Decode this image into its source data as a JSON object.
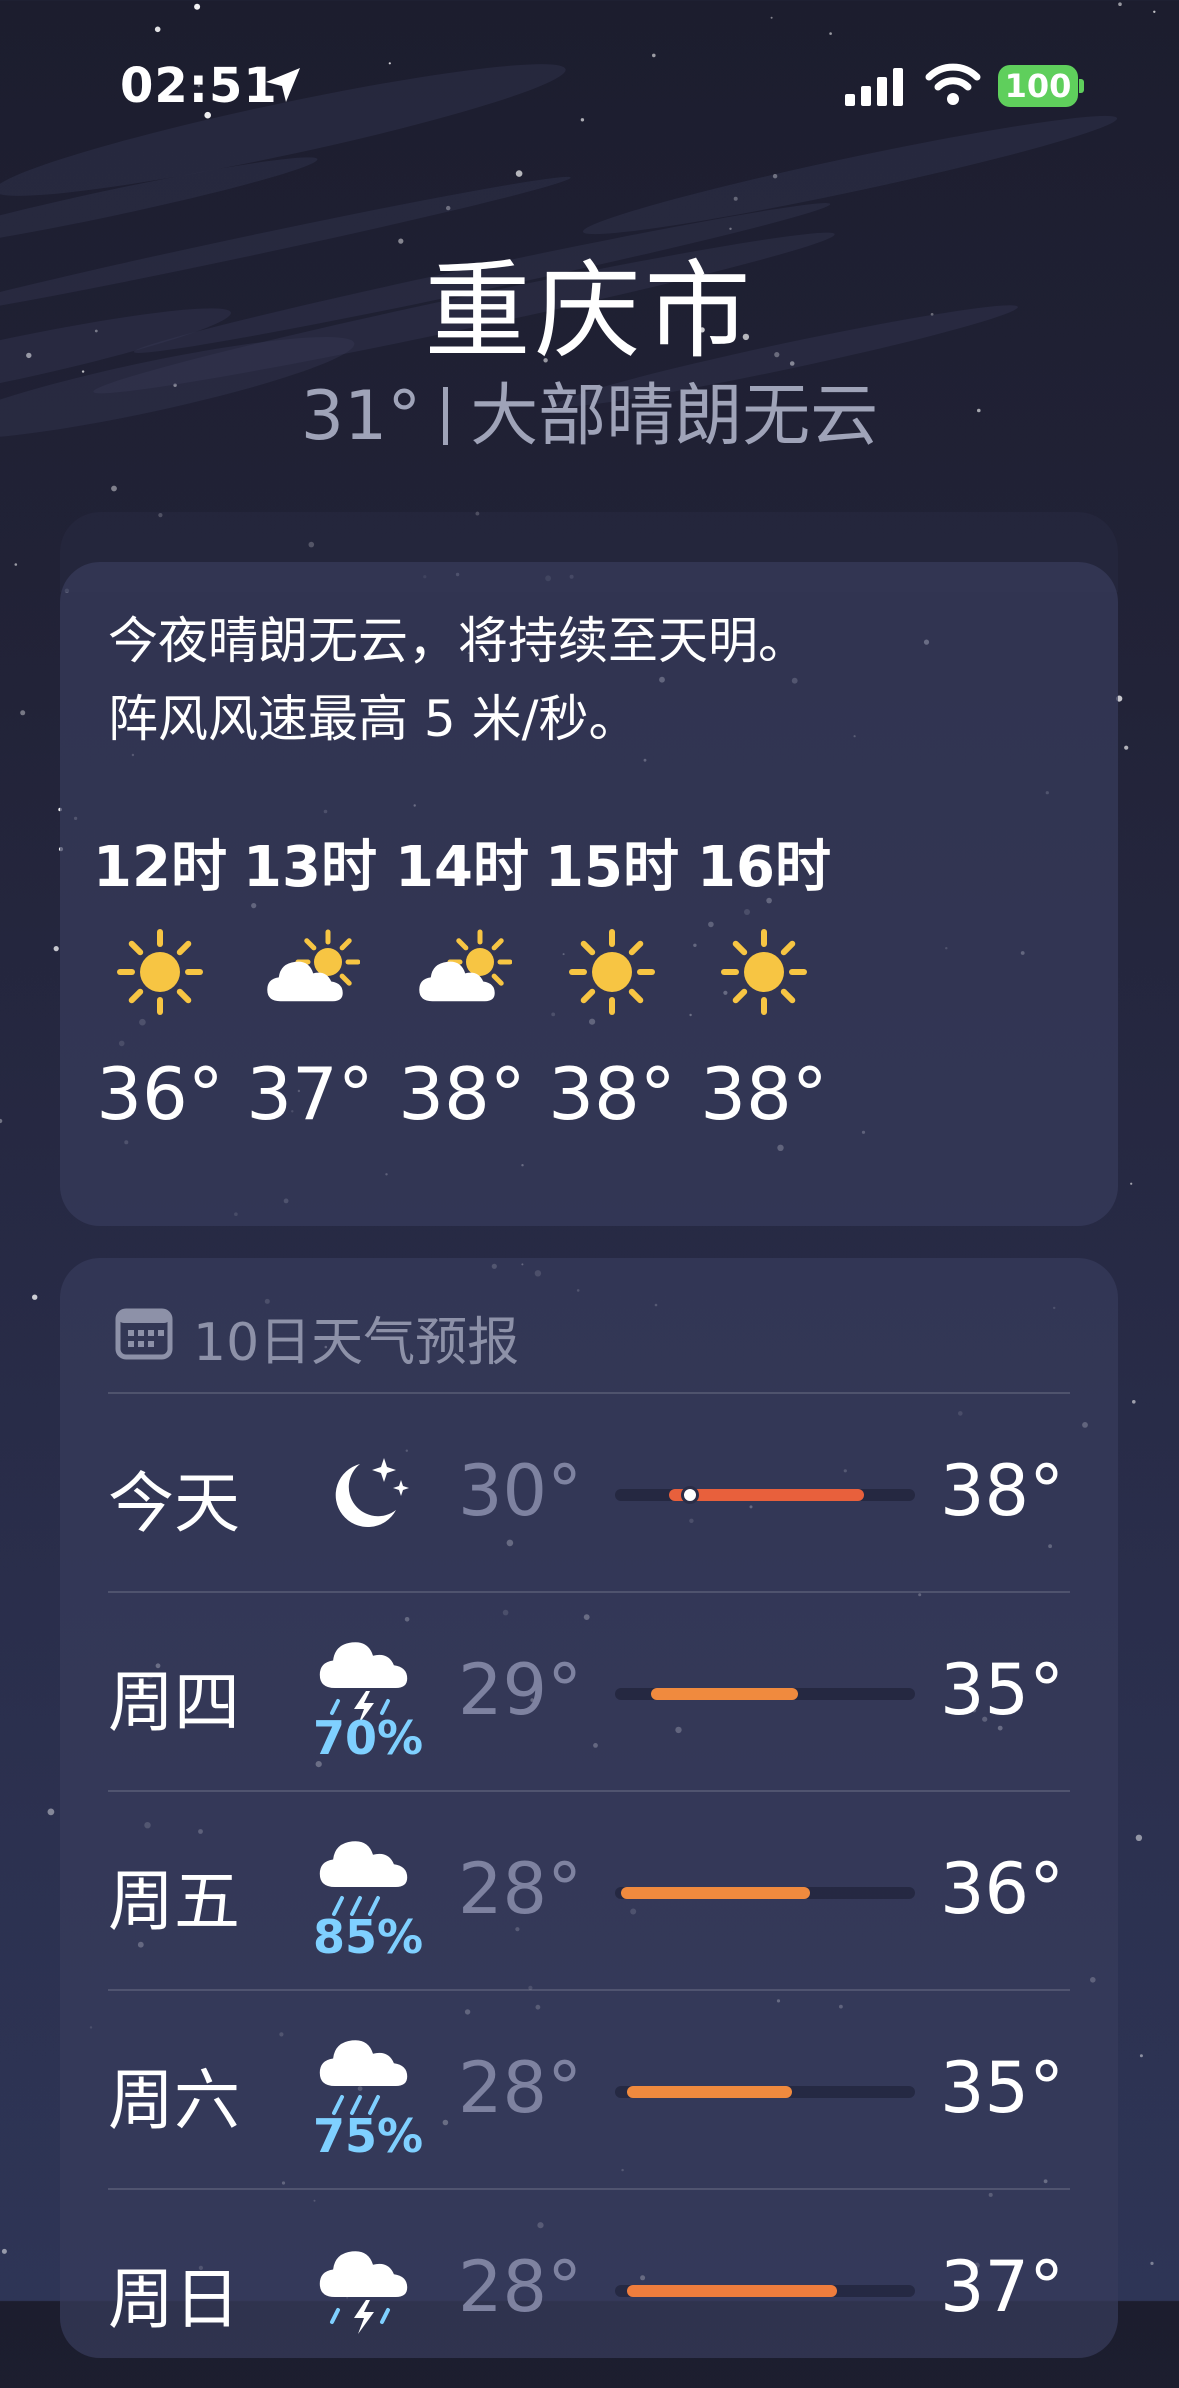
{
  "status_bar": {
    "time": "02:51",
    "battery": "100",
    "icons": [
      "location-arrow-icon",
      "cellular-signal-icon",
      "wifi-icon",
      "battery-icon"
    ]
  },
  "location": {
    "city": "重庆市",
    "current_temp": "31°",
    "condition": "大部晴朗无云"
  },
  "hourly": {
    "summary_line1": "今夜晴朗无云，将持续至天明。",
    "summary_line2": "阵风风速最高 5 米/秒。",
    "hours": [
      {
        "label": "12时",
        "icon": "sun",
        "temp": "36°"
      },
      {
        "label": "13时",
        "icon": "partly-cloudy",
        "temp": "37°"
      },
      {
        "label": "14时",
        "icon": "partly-cloudy",
        "temp": "38°"
      },
      {
        "label": "15时",
        "icon": "sun",
        "temp": "38°"
      },
      {
        "label": "16时",
        "icon": "sun",
        "temp": "38°"
      }
    ]
  },
  "forecast": {
    "title": "10日天气预报",
    "days": [
      {
        "day": "今天",
        "icon": "moon-stars",
        "precip": "",
        "low": "30°",
        "high": "38°",
        "bar_start": 0.18,
        "bar_end": 0.83,
        "current": 0.25,
        "bar_color": "#e8603c"
      },
      {
        "day": "周四",
        "icon": "thunderstorm",
        "precip": "70%",
        "low": "29°",
        "high": "35°",
        "bar_start": 0.12,
        "bar_end": 0.61,
        "current": null,
        "bar_color": "#f08a3e"
      },
      {
        "day": "周五",
        "icon": "rain",
        "precip": "85%",
        "low": "28°",
        "high": "36°",
        "bar_start": 0.02,
        "bar_end": 0.65,
        "current": null,
        "bar_color": "#f08a3e"
      },
      {
        "day": "周六",
        "icon": "rain",
        "precip": "75%",
        "low": "28°",
        "high": "35°",
        "bar_start": 0.04,
        "bar_end": 0.59,
        "current": null,
        "bar_color": "#f08a3e"
      },
      {
        "day": "周日",
        "icon": "thunderstorm",
        "precip": "",
        "low": "28°",
        "high": "37°",
        "bar_start": 0.04,
        "bar_end": 0.74,
        "current": null,
        "bar_color": "#ef7d3d"
      }
    ]
  }
}
